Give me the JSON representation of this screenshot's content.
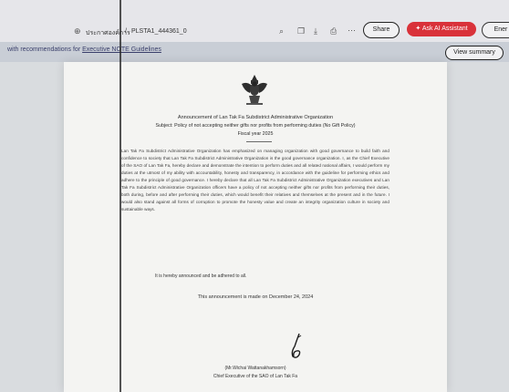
{
  "toolbar": {
    "file_prefix": "ประกาศองค์การ",
    "file_name": "PLSTA1_444361_0",
    "share_label": "Share",
    "ask_ai_label": "Ask AI Assistant",
    "ai_label": "Ener"
  },
  "banner": {
    "prefix": "with recommendations for",
    "link": "Executive NOTE Guidelines",
    "summary_label": "View summary"
  },
  "document": {
    "title_line1": "Announcement of Lan Tak Fa Subdistrict Administrative Organization",
    "title_line2": "Subject: Policy of not accepting neither gifts nor profits from performing duties (No Gift Policy)",
    "title_line3": "Fiscal year 2025",
    "body": "Lan Tak Fa Subdistrict Administrative Organization has emphasized on managing organization with good governance to build faith and confidence to society that Lan Tak Fa Subdistrict Administrative Organization is the good governance organization. I, as the Chief Executive of the SAO of Lan Tak Fa, hereby declare and demonstrate the intention to perform duties and all related national affairs, I would perform my duties at the utmost of my ability with accountability, honesty and transparency, in accordance with the guideline for performing ethics and adhere to the principle of good governance. I hereby declare that all Lan Tak Fa Subdistrict Administrative Organization executives and Lan Tak Fa Subdistrict Administrative Organization officers have a policy of not accepting neither gifts nor profits from performing their duties, both during, before and after performing their duties, which would benefit their relatives and themselves at the present and in the future. I would also stand against all forms of corruption to promote the honesty value and create an integrity organization culture in society and sustainable ways.",
    "closing": "It is hereby announced and be adhered to all.",
    "date_line": "This announcement is made on December 24, 2024",
    "signer_name": "(Mr.Wichai Wattanakhamsorn)",
    "signer_title": "Chief Executive of the SAO of Lan Tak Fa"
  }
}
